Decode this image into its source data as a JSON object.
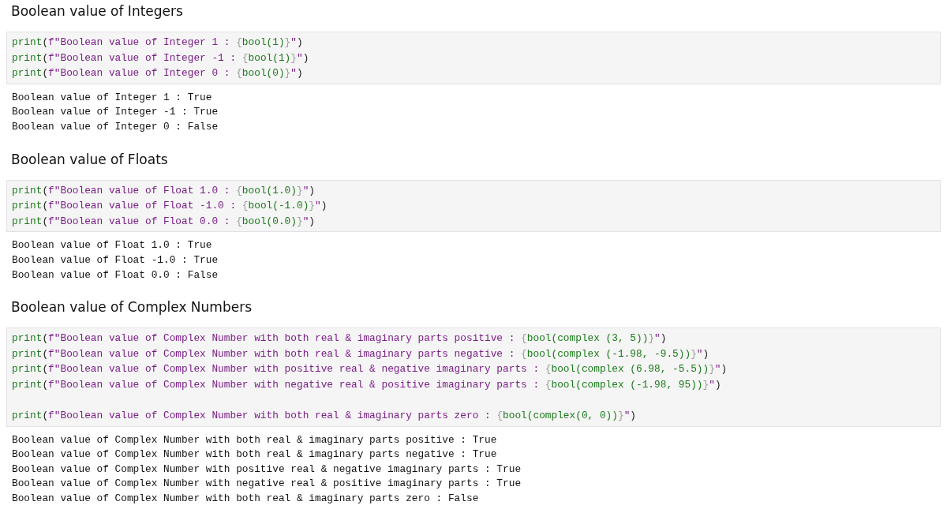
{
  "sections": [
    {
      "heading": "Boolean value of Integers",
      "code": [
        {
          "tokens": [
            {
              "kind": "fn",
              "text": "print"
            },
            {
              "kind": "punct",
              "text": "("
            },
            {
              "kind": "str",
              "text": "f\"Boolean value of Integer 1 : "
            },
            {
              "kind": "brace",
              "text": "{"
            },
            {
              "kind": "expr",
              "text": "bool(1)"
            },
            {
              "kind": "brace",
              "text": "}"
            },
            {
              "kind": "str",
              "text": "\""
            },
            {
              "kind": "punct",
              "text": ")"
            }
          ]
        },
        {
          "tokens": [
            {
              "kind": "fn",
              "text": "print"
            },
            {
              "kind": "punct",
              "text": "("
            },
            {
              "kind": "str",
              "text": "f\"Boolean value of Integer -1 : "
            },
            {
              "kind": "brace",
              "text": "{"
            },
            {
              "kind": "expr",
              "text": "bool(1)"
            },
            {
              "kind": "brace",
              "text": "}"
            },
            {
              "kind": "str",
              "text": "\""
            },
            {
              "kind": "punct",
              "text": ")"
            }
          ]
        },
        {
          "tokens": [
            {
              "kind": "fn",
              "text": "print"
            },
            {
              "kind": "punct",
              "text": "("
            },
            {
              "kind": "str",
              "text": "f\"Boolean value of Integer 0 : "
            },
            {
              "kind": "brace",
              "text": "{"
            },
            {
              "kind": "expr",
              "text": "bool(0)"
            },
            {
              "kind": "brace",
              "text": "}"
            },
            {
              "kind": "str",
              "text": "\""
            },
            {
              "kind": "punct",
              "text": ")"
            }
          ]
        }
      ],
      "output": [
        "Boolean value of Integer 1 : True",
        "Boolean value of Integer -1 : True",
        "Boolean value of Integer 0 : False"
      ]
    },
    {
      "heading": "Boolean value of Floats",
      "code": [
        {
          "tokens": [
            {
              "kind": "fn",
              "text": "print"
            },
            {
              "kind": "punct",
              "text": "("
            },
            {
              "kind": "str",
              "text": "f\"Boolean value of Float 1.0 : "
            },
            {
              "kind": "brace",
              "text": "{"
            },
            {
              "kind": "expr",
              "text": "bool(1.0)"
            },
            {
              "kind": "brace",
              "text": "}"
            },
            {
              "kind": "str",
              "text": "\""
            },
            {
              "kind": "punct",
              "text": ")"
            }
          ]
        },
        {
          "tokens": [
            {
              "kind": "fn",
              "text": "print"
            },
            {
              "kind": "punct",
              "text": "("
            },
            {
              "kind": "str",
              "text": "f\"Boolean value of Float -1.0 : "
            },
            {
              "kind": "brace",
              "text": "{"
            },
            {
              "kind": "expr",
              "text": "bool(-1.0)"
            },
            {
              "kind": "brace",
              "text": "}"
            },
            {
              "kind": "str",
              "text": "\""
            },
            {
              "kind": "punct",
              "text": ")"
            }
          ]
        },
        {
          "tokens": [
            {
              "kind": "fn",
              "text": "print"
            },
            {
              "kind": "punct",
              "text": "("
            },
            {
              "kind": "str",
              "text": "f\"Boolean value of Float 0.0 : "
            },
            {
              "kind": "brace",
              "text": "{"
            },
            {
              "kind": "expr",
              "text": "bool(0.0)"
            },
            {
              "kind": "brace",
              "text": "}"
            },
            {
              "kind": "str",
              "text": "\""
            },
            {
              "kind": "punct",
              "text": ")"
            }
          ]
        }
      ],
      "output": [
        "Boolean value of Float 1.0 : True",
        "Boolean value of Float -1.0 : True",
        "Boolean value of Float 0.0 : False"
      ]
    },
    {
      "heading": "Boolean value of Complex Numbers",
      "code": [
        {
          "tokens": [
            {
              "kind": "fn",
              "text": "print"
            },
            {
              "kind": "punct",
              "text": "("
            },
            {
              "kind": "str",
              "text": "f\"Boolean value of Complex Number with both real & imaginary parts positive : "
            },
            {
              "kind": "brace",
              "text": "{"
            },
            {
              "kind": "expr",
              "text": "bool(complex (3, 5))"
            },
            {
              "kind": "brace",
              "text": "}"
            },
            {
              "kind": "str",
              "text": "\""
            },
            {
              "kind": "punct",
              "text": ")"
            }
          ]
        },
        {
          "tokens": [
            {
              "kind": "fn",
              "text": "print"
            },
            {
              "kind": "punct",
              "text": "("
            },
            {
              "kind": "str",
              "text": "f\"Boolean value of Complex Number with both real & imaginary parts negative : "
            },
            {
              "kind": "brace",
              "text": "{"
            },
            {
              "kind": "expr",
              "text": "bool(complex (-1.98, -9.5))"
            },
            {
              "kind": "brace",
              "text": "}"
            },
            {
              "kind": "str",
              "text": "\""
            },
            {
              "kind": "punct",
              "text": ")"
            }
          ]
        },
        {
          "tokens": [
            {
              "kind": "fn",
              "text": "print"
            },
            {
              "kind": "punct",
              "text": "("
            },
            {
              "kind": "str",
              "text": "f\"Boolean value of Complex Number with positive real & negative imaginary parts : "
            },
            {
              "kind": "brace",
              "text": "{"
            },
            {
              "kind": "expr",
              "text": "bool(complex (6.98, -5.5))"
            },
            {
              "kind": "brace",
              "text": "}"
            },
            {
              "kind": "str",
              "text": "\""
            },
            {
              "kind": "punct",
              "text": ")"
            }
          ]
        },
        {
          "tokens": [
            {
              "kind": "fn",
              "text": "print"
            },
            {
              "kind": "punct",
              "text": "("
            },
            {
              "kind": "str",
              "text": "f\"Boolean value of Complex Number with negative real & positive imaginary parts : "
            },
            {
              "kind": "brace",
              "text": "{"
            },
            {
              "kind": "expr",
              "text": "bool(complex (-1.98, 95))"
            },
            {
              "kind": "brace",
              "text": "}"
            },
            {
              "kind": "str",
              "text": "\""
            },
            {
              "kind": "punct",
              "text": ")"
            }
          ]
        },
        {
          "gap_before": true,
          "tokens": [
            {
              "kind": "fn",
              "text": "print"
            },
            {
              "kind": "punct",
              "text": "("
            },
            {
              "kind": "str",
              "text": "f\"Boolean value of Complex Number with both real & imaginary parts zero : "
            },
            {
              "kind": "brace",
              "text": "{"
            },
            {
              "kind": "expr",
              "text": "bool(complex(0, 0))"
            },
            {
              "kind": "brace",
              "text": "}"
            },
            {
              "kind": "str",
              "text": "\""
            },
            {
              "kind": "punct",
              "text": ")"
            }
          ]
        }
      ],
      "output": [
        "Boolean value of Complex Number with both real & imaginary parts positive : True",
        "Boolean value of Complex Number with both real & imaginary parts negative : True",
        "Boolean value of Complex Number with positive real & negative imaginary parts : True",
        "Boolean value of Complex Number with negative real & positive imaginary parts : True",
        "Boolean value of Complex Number with both real & imaginary parts zero : False"
      ]
    }
  ]
}
